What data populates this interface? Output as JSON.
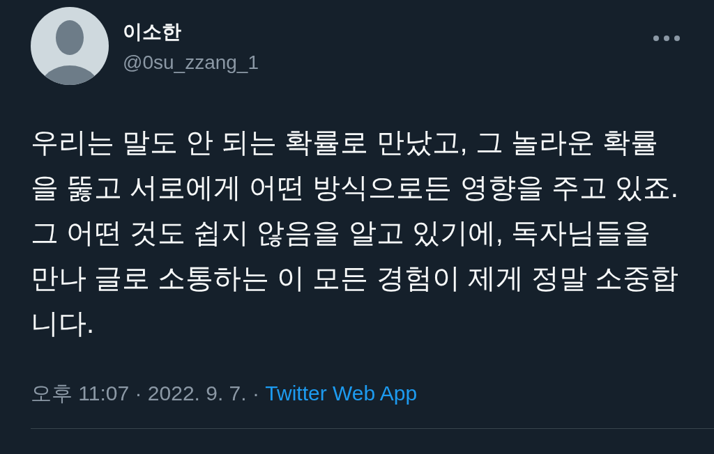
{
  "author": {
    "name": "이소한",
    "handle": "@0su_zzang_1"
  },
  "tweet": {
    "text": "우리는 말도 안 되는 확률로 만났고, 그 놀라운 확률을 뚫고 서로에게 어떤 방식으로든 영향을 주고 있죠. 그 어떤 것도 쉽지 않음을 알고 있기에, 독자님들을 만나 글로 소통하는 이 모든 경험이 제게 정말 소중합니다."
  },
  "footer": {
    "meta": "오후 11:07 · 2022. 9. 7. · ",
    "source": "Twitter Web App"
  }
}
